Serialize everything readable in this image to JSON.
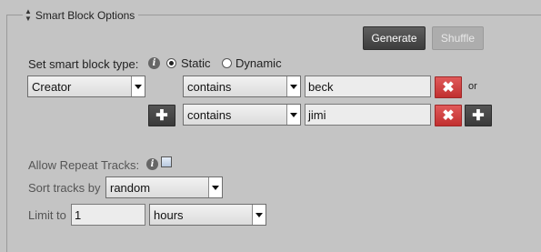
{
  "panel": {
    "legend": "Smart Block Options"
  },
  "toolbar": {
    "generate_label": "Generate",
    "shuffle_label": "Shuffle"
  },
  "type_row": {
    "label": "Set smart block type:",
    "info_icon": "i",
    "options": [
      "Static",
      "Dynamic"
    ],
    "selected": "Static"
  },
  "criteria": {
    "field": "Creator",
    "rows": [
      {
        "modifier": "contains",
        "value": "beck",
        "connector": "or"
      },
      {
        "modifier": "contains",
        "value": "jimi"
      }
    ],
    "remove_icon": "close-icon",
    "add_icon": "plus-icon",
    "colors": {
      "remove": "#cc3333",
      "add": "#444444"
    }
  },
  "options": {
    "repeat_label": "Allow Repeat Tracks:",
    "repeat_checked": false,
    "sort_label": "Sort tracks by",
    "sort_value": "random",
    "limit_label": "Limit to",
    "limit_value": "1",
    "limit_unit": "hours"
  }
}
